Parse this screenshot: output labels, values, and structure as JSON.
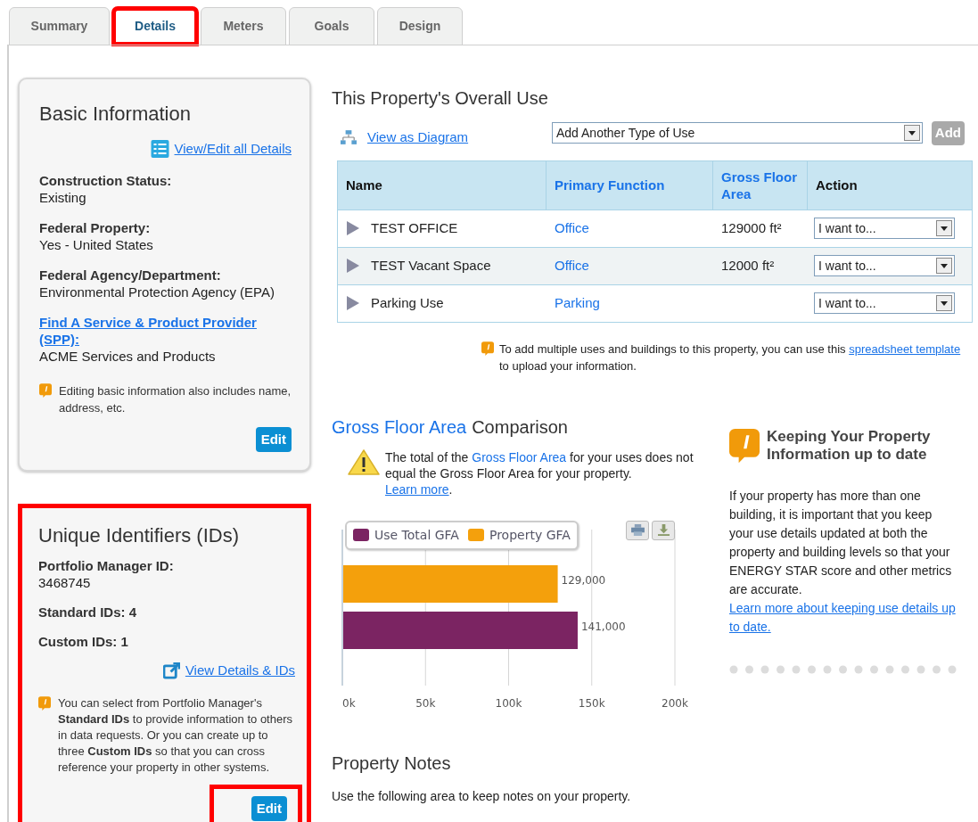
{
  "tabs": [
    {
      "label": "Summary",
      "selected": false,
      "highlighted": false
    },
    {
      "label": "Details",
      "selected": true,
      "highlighted": true
    },
    {
      "label": "Meters",
      "selected": false,
      "highlighted": false
    },
    {
      "label": "Goals",
      "selected": false,
      "highlighted": false
    },
    {
      "label": "Design",
      "selected": false,
      "highlighted": false
    }
  ],
  "basic_information": {
    "title": "Basic Information",
    "view_edit_link": "View/Edit all Details",
    "highlighted": false,
    "fields": [
      {
        "kind": "plain",
        "label": "Construction Status:",
        "value": "Existing"
      },
      {
        "kind": "plain",
        "label": "Federal Property:",
        "value": "Yes - United States"
      },
      {
        "kind": "plain",
        "label": "Federal Agency/Department:",
        "value": "Environmental Protection Agency (EPA)"
      },
      {
        "kind": "link",
        "label": "Find A Service & Product Provider (SPP):",
        "value": "ACME Services and Products"
      }
    ],
    "note": "Editing basic information also includes name, address, etc.",
    "edit_button": {
      "label": "Edit",
      "highlighted": false
    }
  },
  "unique_identifiers": {
    "title": "Unique Identifiers (IDs)",
    "highlighted": true,
    "fields": [
      {
        "kind": "stacked",
        "label": "Portfolio Manager ID:",
        "value": "3468745"
      },
      {
        "kind": "inline",
        "text": "Standard IDs: 4"
      },
      {
        "kind": "inline",
        "text": "Custom IDs: 1"
      }
    ],
    "view_link": "View Details & IDs",
    "note": "You can select from Portfolio Manager's **Standard IDs** to provide information to others in data requests. Or you can create up to three **Custom IDs** so that you can cross reference your property in other systems.",
    "edit_button": {
      "label": "Edit",
      "highlighted": true
    }
  },
  "overall_use": {
    "title": "This Property's Overall Use",
    "diagram_link": "View as Diagram",
    "type_select": {
      "value": "Add Another Type of Use"
    },
    "add_button": {
      "label": "Add",
      "disabled": true
    },
    "columns": [
      {
        "label": "Name",
        "kind": "plain"
      },
      {
        "label": "Primary Function",
        "kind": "link"
      },
      {
        "label": "Gross Floor Area",
        "kind": "link"
      },
      {
        "label": "Action",
        "kind": "plain"
      }
    ],
    "rows": [
      {
        "name": "TEST OFFICE",
        "primary_function": "Office",
        "gross_floor_area": "129000 ft²",
        "action": "I want to...",
        "expanded": false
      },
      {
        "name": "TEST Vacant Space",
        "primary_function": "Office",
        "gross_floor_area": "12000 ft²",
        "action": "I want to...",
        "expanded": false
      },
      {
        "name": "Parking Use",
        "primary_function": "Parking",
        "action": "I want to...",
        "expanded": false
      }
    ],
    "note": {
      "text": "To add multiple uses and buildings to this property, you can use this",
      "link": "spreadsheet template",
      "after": "to upload your information."
    }
  },
  "gfa_comparison": {
    "title_term": "Gross Floor Area",
    "title_rest": "Comparison",
    "warning": {
      "before": "The total of the",
      "term": "Gross Floor Area",
      "after": "for your uses does not equal the Gross Floor Area for your property.",
      "link": "Learn more",
      "end": "."
    },
    "chart_data": {
      "type": "bar",
      "orientation": "horizontal",
      "xlim": [
        0,
        200000
      ],
      "xticks": [
        {
          "value": 0,
          "label": "0k"
        },
        {
          "value": 50000,
          "label": "50k"
        },
        {
          "value": 100000,
          "label": "100k"
        },
        {
          "value": 150000,
          "label": "150k"
        },
        {
          "value": 200000,
          "label": "200k"
        }
      ],
      "grid": true,
      "legend": true,
      "value_labels": [
        "129,000",
        "141,000"
      ],
      "series": [
        {
          "name": "Use Total GFA",
          "color": "#7b2462",
          "values": [
            null,
            141000
          ]
        },
        {
          "name": "Property GFA",
          "color": "#f4a00c",
          "values": [
            129000,
            null
          ]
        }
      ]
    }
  },
  "info_panel": {
    "title": "Keeping Your Property Information up to date",
    "body": "If your property has more than one building, it is important that you keep your use details updated at both the property and building levels so that your ENERGY STAR score and other metrics are accurate.",
    "link": "Learn more about keeping use details up to date."
  },
  "property_notes": {
    "title": "Property Notes",
    "text": "Use the following area to keep notes on your property."
  }
}
